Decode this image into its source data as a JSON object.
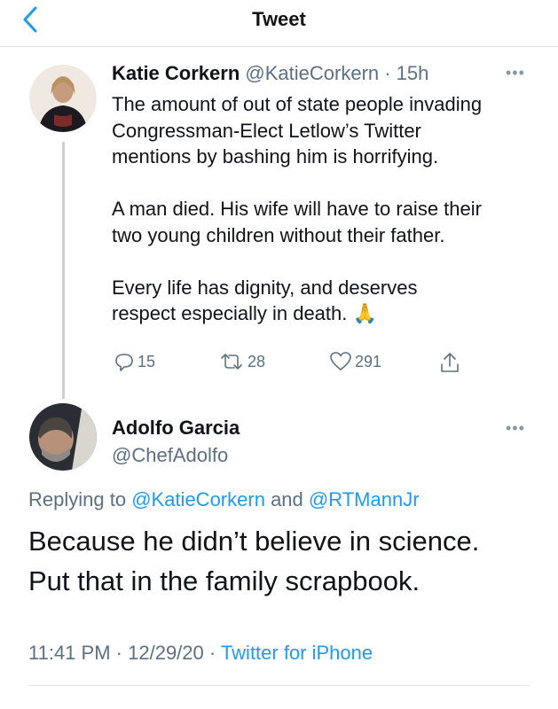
{
  "nav": {
    "title": "Tweet",
    "back_icon": "chevron-left-icon"
  },
  "colors": {
    "accent": "#1d9bf0",
    "muted": "#5b7083",
    "text": "#0f1419"
  },
  "tweet": {
    "author_name": "Katie Corkern",
    "handle_time": "@KatieCorkern · 15h",
    "text": "The amount of out of state people invading\nCongressman-Elect Letlow’s Twitter\nmentions by bashing him is horrifying.\n\nA man died. His wife will have to raise their\ntwo young children without their father.\n\nEvery life has dignity, and deserves\nrespect especially in death. 🙏",
    "replies": "15",
    "retweets": "28",
    "likes": "291"
  },
  "reply": {
    "author_name": "Adolfo Garcia",
    "handle": "@ChefAdolfo",
    "replying_prefix": "Replying to",
    "replying_user1": "@KatieCorkern",
    "replying_and": "and",
    "replying_user2": "@RTMannJr",
    "text": "Because he didn’t believe in science.\nPut that in the family scrapbook.",
    "time": "11:41 PM",
    "date": "12/29/20",
    "source": "Twitter for iPhone"
  },
  "more_label": "•••"
}
